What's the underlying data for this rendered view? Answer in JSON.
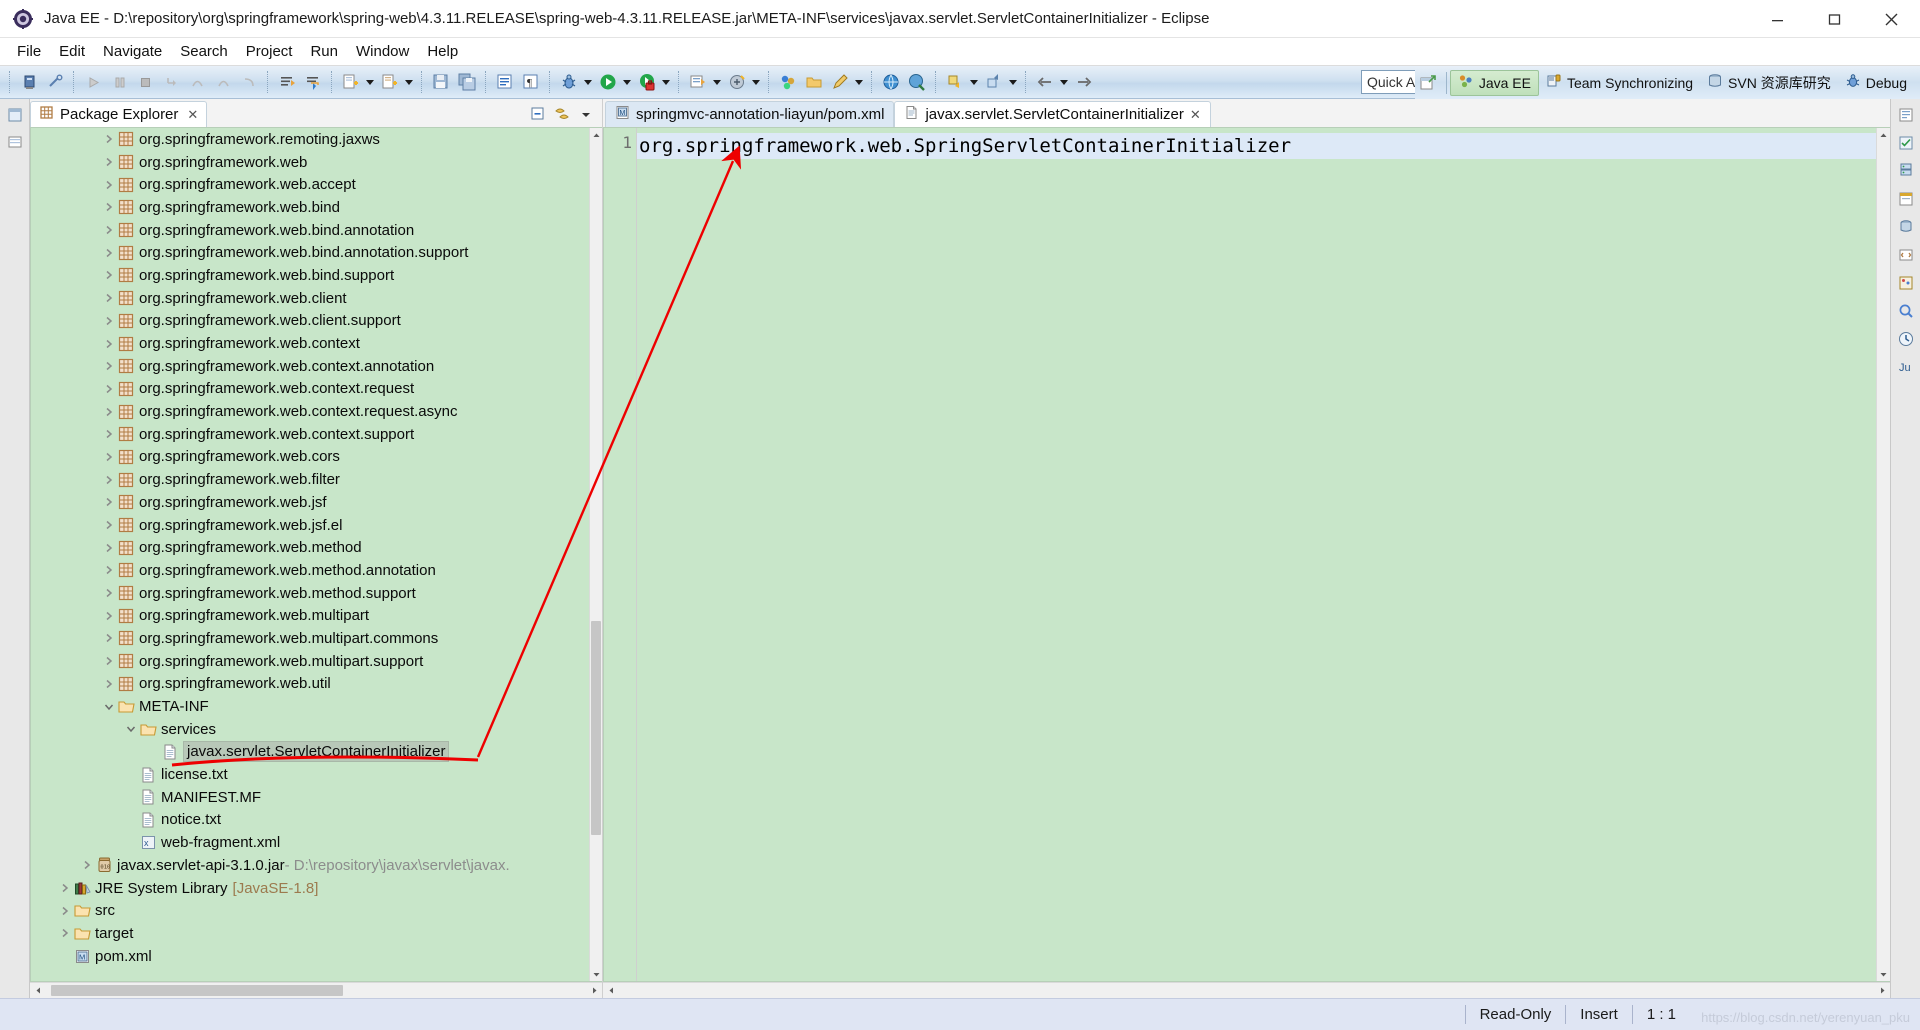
{
  "window": {
    "title": "Java EE - D:\\repository\\org\\springframework\\spring-web\\4.3.11.RELEASE\\spring-web-4.3.11.RELEASE.jar\\META-INF\\services\\javax.servlet.ServletContainerInitializer - Eclipse",
    "app_icon": "eclipse-icon",
    "minimize_label": "Minimize",
    "maximize_label": "Maximize",
    "close_label": "Close"
  },
  "menubar": {
    "items": [
      {
        "label": "File"
      },
      {
        "label": "Edit"
      },
      {
        "label": "Navigate"
      },
      {
        "label": "Search"
      },
      {
        "label": "Project"
      },
      {
        "label": "Run"
      },
      {
        "label": "Window"
      },
      {
        "label": "Help"
      }
    ]
  },
  "toolbar": {
    "quick_access_placeholder": "Quick Access",
    "quick_access_value": "Quick Access",
    "perspectives": [
      {
        "label": "Java EE",
        "icon": "javaee-perspective-icon",
        "active": true
      },
      {
        "label": "Team Synchronizing",
        "icon": "team-sync-icon",
        "active": false
      },
      {
        "label": "SVN 资源库研究",
        "icon": "svn-repo-icon",
        "active": false
      },
      {
        "label": "Debug",
        "icon": "debug-perspective-icon",
        "active": false
      }
    ],
    "open_perspective_label": "Open Perspective"
  },
  "explorer": {
    "tab_label": "Package Explorer",
    "tab_icon": "package-explorer-icon",
    "close_label": "✕",
    "tools": [
      {
        "name": "collapse-all-icon",
        "label": "Collapse All"
      },
      {
        "name": "link-with-editor-icon",
        "label": "Link with Editor"
      },
      {
        "name": "view-menu-icon",
        "label": "View Menu"
      }
    ],
    "tree": [
      {
        "indent": 3,
        "twist": "collapsed",
        "icon": "package-icon",
        "label": "org.springframework.remoting.jaxws"
      },
      {
        "indent": 3,
        "twist": "collapsed",
        "icon": "package-icon",
        "label": "org.springframework.web"
      },
      {
        "indent": 3,
        "twist": "collapsed",
        "icon": "package-icon",
        "label": "org.springframework.web.accept"
      },
      {
        "indent": 3,
        "twist": "collapsed",
        "icon": "package-icon",
        "label": "org.springframework.web.bind"
      },
      {
        "indent": 3,
        "twist": "collapsed",
        "icon": "package-icon",
        "label": "org.springframework.web.bind.annotation"
      },
      {
        "indent": 3,
        "twist": "collapsed",
        "icon": "package-icon",
        "label": "org.springframework.web.bind.annotation.support"
      },
      {
        "indent": 3,
        "twist": "collapsed",
        "icon": "package-icon",
        "label": "org.springframework.web.bind.support"
      },
      {
        "indent": 3,
        "twist": "collapsed",
        "icon": "package-icon",
        "label": "org.springframework.web.client"
      },
      {
        "indent": 3,
        "twist": "collapsed",
        "icon": "package-icon",
        "label": "org.springframework.web.client.support"
      },
      {
        "indent": 3,
        "twist": "collapsed",
        "icon": "package-icon",
        "label": "org.springframework.web.context"
      },
      {
        "indent": 3,
        "twist": "collapsed",
        "icon": "package-icon",
        "label": "org.springframework.web.context.annotation"
      },
      {
        "indent": 3,
        "twist": "collapsed",
        "icon": "package-icon",
        "label": "org.springframework.web.context.request"
      },
      {
        "indent": 3,
        "twist": "collapsed",
        "icon": "package-icon",
        "label": "org.springframework.web.context.request.async"
      },
      {
        "indent": 3,
        "twist": "collapsed",
        "icon": "package-icon",
        "label": "org.springframework.web.context.support"
      },
      {
        "indent": 3,
        "twist": "collapsed",
        "icon": "package-icon",
        "label": "org.springframework.web.cors"
      },
      {
        "indent": 3,
        "twist": "collapsed",
        "icon": "package-icon",
        "label": "org.springframework.web.filter"
      },
      {
        "indent": 3,
        "twist": "collapsed",
        "icon": "package-icon",
        "label": "org.springframework.web.jsf"
      },
      {
        "indent": 3,
        "twist": "collapsed",
        "icon": "package-icon",
        "label": "org.springframework.web.jsf.el"
      },
      {
        "indent": 3,
        "twist": "collapsed",
        "icon": "package-icon",
        "label": "org.springframework.web.method"
      },
      {
        "indent": 3,
        "twist": "collapsed",
        "icon": "package-icon",
        "label": "org.springframework.web.method.annotation"
      },
      {
        "indent": 3,
        "twist": "collapsed",
        "icon": "package-icon",
        "label": "org.springframework.web.method.support"
      },
      {
        "indent": 3,
        "twist": "collapsed",
        "icon": "package-icon",
        "label": "org.springframework.web.multipart"
      },
      {
        "indent": 3,
        "twist": "collapsed",
        "icon": "package-icon",
        "label": "org.springframework.web.multipart.commons"
      },
      {
        "indent": 3,
        "twist": "collapsed",
        "icon": "package-icon",
        "label": "org.springframework.web.multipart.support"
      },
      {
        "indent": 3,
        "twist": "collapsed",
        "icon": "package-icon",
        "label": "org.springframework.web.util"
      },
      {
        "indent": 3,
        "twist": "expanded",
        "icon": "folder-icon",
        "label": "META-INF"
      },
      {
        "indent": 4,
        "twist": "expanded",
        "icon": "folder-icon",
        "label": "services"
      },
      {
        "indent": 5,
        "twist": "none",
        "icon": "file-icon",
        "label": "javax.servlet.ServletContainerInitializer",
        "selected": true,
        "underlined": true
      },
      {
        "indent": 4,
        "twist": "none",
        "icon": "file-icon",
        "label": "license.txt"
      },
      {
        "indent": 4,
        "twist": "none",
        "icon": "file-icon",
        "label": "MANIFEST.MF"
      },
      {
        "indent": 4,
        "twist": "none",
        "icon": "file-icon",
        "label": "notice.txt"
      },
      {
        "indent": 4,
        "twist": "none",
        "icon": "xml-file-icon",
        "label": "web-fragment.xml"
      },
      {
        "indent": 2,
        "twist": "collapsed",
        "icon": "jar-icon",
        "label": "javax.servlet-api-3.1.0.jar",
        "sub": " - D:\\repository\\javax\\servlet\\javax."
      },
      {
        "indent": 1,
        "twist": "collapsed",
        "icon": "library-icon",
        "label": "JRE System Library",
        "bracket": "[JavaSE-1.8]"
      },
      {
        "indent": 1,
        "twist": "collapsed",
        "icon": "folder-icon",
        "label": "src"
      },
      {
        "indent": 1,
        "twist": "collapsed",
        "icon": "folder-icon",
        "label": "target"
      },
      {
        "indent": 1,
        "twist": "none",
        "icon": "maven-pom-icon",
        "label": "pom.xml"
      }
    ]
  },
  "editor": {
    "tabs": [
      {
        "label": "springmvc-annotation-liayun/pom.xml",
        "icon": "maven-pom-icon",
        "active": false,
        "close": ""
      },
      {
        "label": "javax.servlet.ServletContainerInitializer",
        "icon": "file-icon",
        "active": true,
        "close": "✕"
      }
    ],
    "line_numbers": [
      "1"
    ],
    "lines": [
      "org.springframework.web.SpringServletContainerInitializer"
    ]
  },
  "statusbar": {
    "read_only": "Read-Only",
    "insert_mode": "Insert",
    "cursor_position": "1 : 1",
    "watermark": "https://blog.csdn.net/yerenyuan_pku"
  },
  "colors": {
    "editor_background": "#c8e6c9",
    "tree_background": "#c8e6c9",
    "current_line": "#dde9f7",
    "selection": "#b8c8b8",
    "annotation": "#ee0000",
    "toolbar_gradient_top": "#e8f0f8",
    "statusbar": "#dfe5f3"
  }
}
